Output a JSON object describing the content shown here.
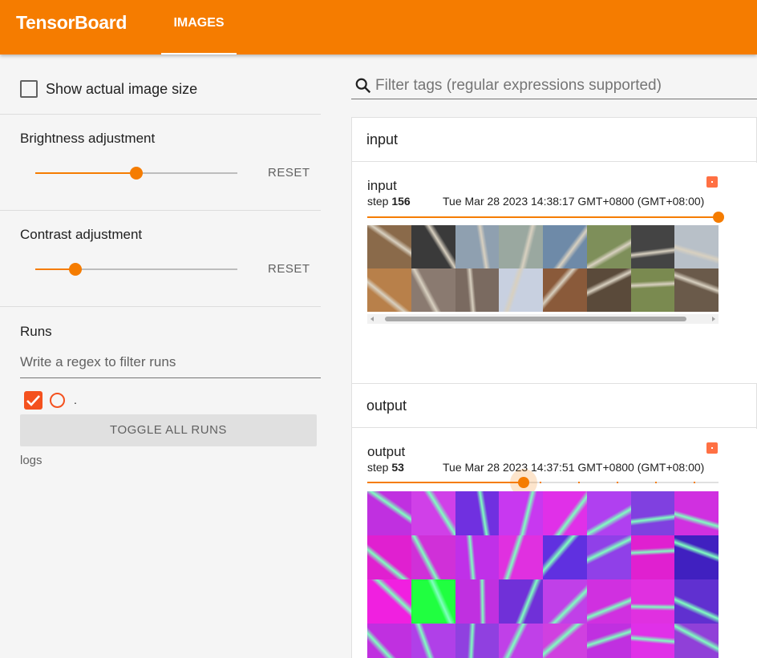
{
  "header": {
    "brand": "TensorBoard",
    "tab": "IMAGES"
  },
  "sidebar": {
    "show_actual_size": {
      "label": "Show actual image size",
      "checked": false
    },
    "brightness": {
      "label": "Brightness adjustment",
      "value": 0.5,
      "reset": "RESET"
    },
    "contrast": {
      "label": "Contrast adjustment",
      "value": 0.2,
      "reset": "RESET"
    },
    "runs": {
      "title": "Runs",
      "placeholder": "Write a regex to filter runs",
      "run_name": ".",
      "run_checked": true,
      "toggle": "TOGGLE ALL RUNS",
      "logdir": "logs"
    }
  },
  "main": {
    "filter_placeholder": "Filter tags (regular expressions supported)",
    "groups": [
      {
        "title": "input",
        "card": {
          "tag": "input",
          "step_label": "step",
          "step": "156",
          "time": "Tue Mar 28 2023 14:38:17 GMT+0800 (GMT+08:00)",
          "step_fraction": 1.0,
          "rows": 2,
          "colors": [
            "#8a6a4a",
            "#3a3a3a",
            "#8fa0b0",
            "#9aa8a0",
            "#6e8aa8",
            "#7e8f5a",
            "#444444",
            "#b8c0c8",
            "#b8804a",
            "#8a7a70",
            "#7a6a60",
            "#c8d0e0",
            "#8a5a3a",
            "#5a4a3a",
            "#7a8a50",
            "#6a5a4a"
          ]
        }
      },
      {
        "title": "output",
        "card": {
          "tag": "output",
          "step_label": "step",
          "step": "53",
          "time": "Tue Mar 28 2023 14:37:51 GMT+0800 (GMT+08:00)",
          "step_fraction": 0.445,
          "rows": 4,
          "colors": [
            "#c030e0",
            "#d040e8",
            "#7030e0",
            "#c838f0",
            "#e030e8",
            "#b040f0",
            "#8040e0",
            "#d030e0",
            "#e020d0",
            "#d030d8",
            "#c030e8",
            "#e030e0",
            "#6030e0",
            "#9040e8",
            "#e020d0",
            "#4020c0",
            "#f020e0",
            "#20ff40",
            "#c030e0",
            "#7030d8",
            "#c040e8",
            "#d030e0",
            "#e030e0",
            "#6030d0",
            "#c030e0",
            "#b040e8",
            "#9040e0",
            "#c040e8",
            "#d040e0",
            "#c030e0",
            "#e030e8",
            "#9040d8"
          ]
        }
      }
    ]
  }
}
